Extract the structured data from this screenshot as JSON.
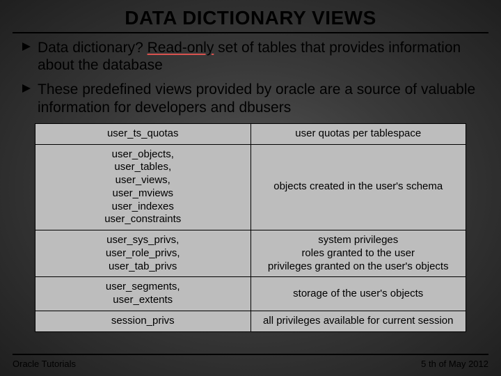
{
  "title": "DATA DICTIONARY VIEWS",
  "bullets": {
    "b1_prefix": "Data dictionary? ",
    "b1_emphasis": "Read-only",
    "b1_suffix": " set of tables that provides information about the database",
    "b2": "These predefined views provided by oracle are a source of valuable information for developers and dbusers"
  },
  "table": {
    "rows": [
      {
        "left": [
          "user_ts_quotas"
        ],
        "right": [
          "user quotas per tablespace"
        ]
      },
      {
        "left": [
          "user_objects,",
          "user_tables,",
          "user_views,",
          "user_mviews",
          "user_indexes",
          "user_constraints"
        ],
        "right": [
          "objects created in the user's schema"
        ]
      },
      {
        "left": [
          "user_sys_privs,",
          "user_role_privs,",
          "user_tab_privs"
        ],
        "right": [
          "system privileges",
          "roles granted to the user",
          "privileges granted on the user's objects"
        ]
      },
      {
        "left": [
          "user_segments,",
          "user_extents"
        ],
        "right": [
          "storage of the user's objects"
        ]
      },
      {
        "left": [
          "session_privs"
        ],
        "right": [
          "all privileges available for current session"
        ]
      }
    ]
  },
  "footer": {
    "left": "Oracle Tutorials",
    "right": "5 th of May 2012"
  }
}
